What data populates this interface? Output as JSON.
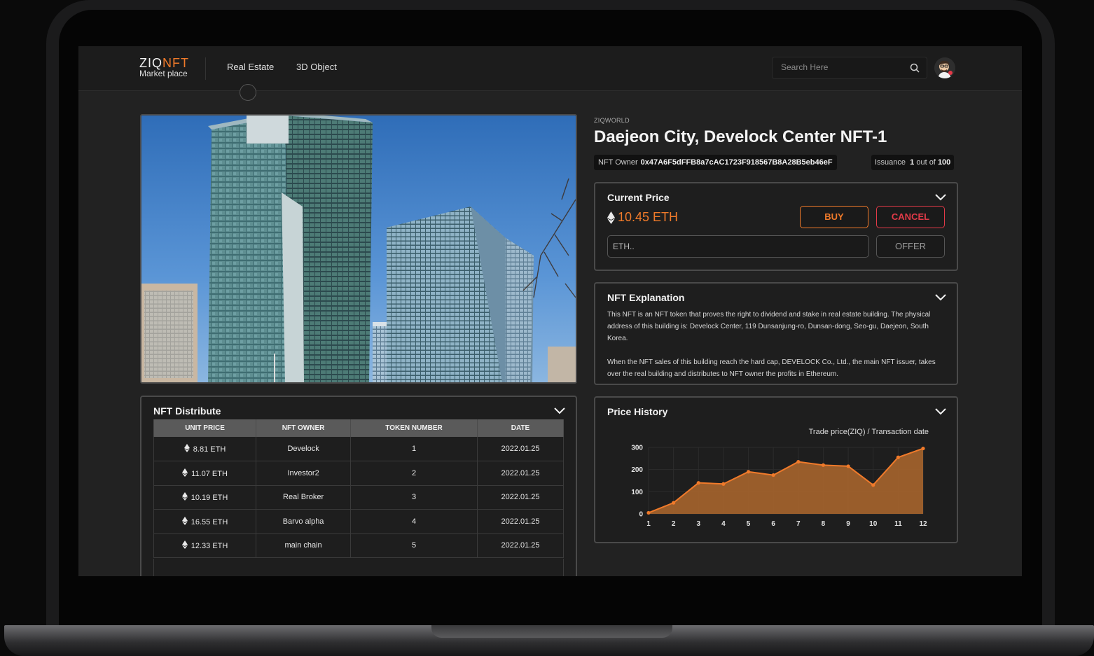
{
  "app": {
    "logo_main": "ZIQ",
    "logo_accent": "NFT",
    "logo_sub": "Market place"
  },
  "nav": {
    "items": [
      {
        "label": "Real Estate"
      },
      {
        "label": "3D Object"
      }
    ]
  },
  "search": {
    "placeholder": "Search Here"
  },
  "nft": {
    "collection": "ZIQWORLD",
    "title": "Daejeon City, Develock Center NFT-1",
    "owner_label": "NFT Owner",
    "owner_address": "0x47A6F5dFFB8a7cAC1723F918567B8A28B5eb46eF",
    "issuance_label": "Issuance",
    "issuance_current": "1",
    "issuance_of": "out of",
    "issuance_total": "100"
  },
  "price_panel": {
    "title": "Current Price",
    "price": "10.45 ETH",
    "buy_label": "BUY",
    "cancel_label": "CANCEL",
    "offer_placeholder": "ETH..",
    "offer_label": "OFFER"
  },
  "explanation": {
    "title": "NFT Explanation",
    "paragraph1": "This NFT is an NFT token that proves the right to dividend and stake in real estate building. The physical address of this building is: Develock Center, 119 Dunsanjung-ro, Dunsan-dong, Seo-gu, Daejeon, South Korea.",
    "paragraph2": "When the NFT sales of this building reach the hard cap, DEVELOCK Co., Ltd., the main NFT issuer, takes over the real building and distributes to NFT owner the profits in Ethereum."
  },
  "distribute": {
    "title": "NFT Distribute",
    "columns": [
      "UNIT PRICE",
      "NFT OWNER",
      "TOKEN NUMBER",
      "DATE"
    ],
    "rows": [
      {
        "price": "8.81 ETH",
        "owner": "Develock",
        "token": "1",
        "date": "2022.01.25"
      },
      {
        "price": "11.07 ETH",
        "owner": "Investor2",
        "token": "2",
        "date": "2022.01.25"
      },
      {
        "price": "10.19 ETH",
        "owner": "Real Broker",
        "token": "3",
        "date": "2022.01.25"
      },
      {
        "price": "16.55 ETH",
        "owner": "Barvo alpha",
        "token": "4",
        "date": "2022.01.25"
      },
      {
        "price": "12.33 ETH",
        "owner": "main chain",
        "token": "5",
        "date": "2022.01.25"
      }
    ]
  },
  "history": {
    "title": "Price History",
    "caption": "Trade price(ZIQ) / Transaction date"
  },
  "chart_data": {
    "type": "area",
    "x": [
      1,
      2,
      3,
      4,
      5,
      6,
      7,
      8,
      9,
      10,
      11,
      12
    ],
    "values": [
      5,
      50,
      140,
      135,
      190,
      175,
      235,
      220,
      215,
      130,
      255,
      295
    ],
    "ylim": [
      0,
      300
    ],
    "yticks": [
      0,
      100,
      200,
      300
    ],
    "grid": true,
    "colors": {
      "fill": "#a0612c",
      "line": "#f07a2a",
      "point": "#f07a2a"
    }
  },
  "theme": {
    "accent": "#f07a2a",
    "danger": "#e23a48"
  }
}
